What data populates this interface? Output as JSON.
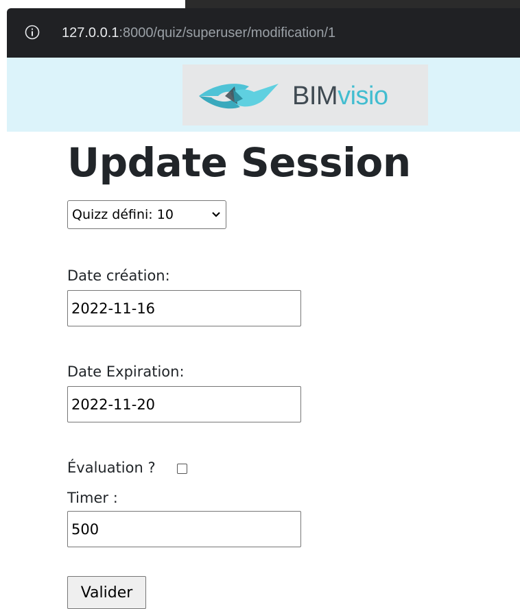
{
  "browser": {
    "url_host": "127.0.0.1",
    "url_rest": ":8000/quiz/superuser/modification/1",
    "info_icon": "info-icon"
  },
  "logo": {
    "brand_part1": "BIM",
    "brand_part2": "visio",
    "colors": {
      "bim": "#3f4a52",
      "visio": "#42bdd0",
      "banner_bg": "#dcf3fa"
    }
  },
  "form": {
    "title": "Update Session",
    "quiz_select": {
      "selected": "Quizz défini: 10"
    },
    "date_creation": {
      "label": "Date création:",
      "value": "2022-11-16"
    },
    "date_expiration": {
      "label": "Date Expiration:",
      "value": "2022-11-20"
    },
    "evaluation": {
      "label": "Évaluation ?",
      "checked": false
    },
    "timer": {
      "label": "Timer :",
      "value": "500"
    },
    "submit_label": "Valider"
  }
}
